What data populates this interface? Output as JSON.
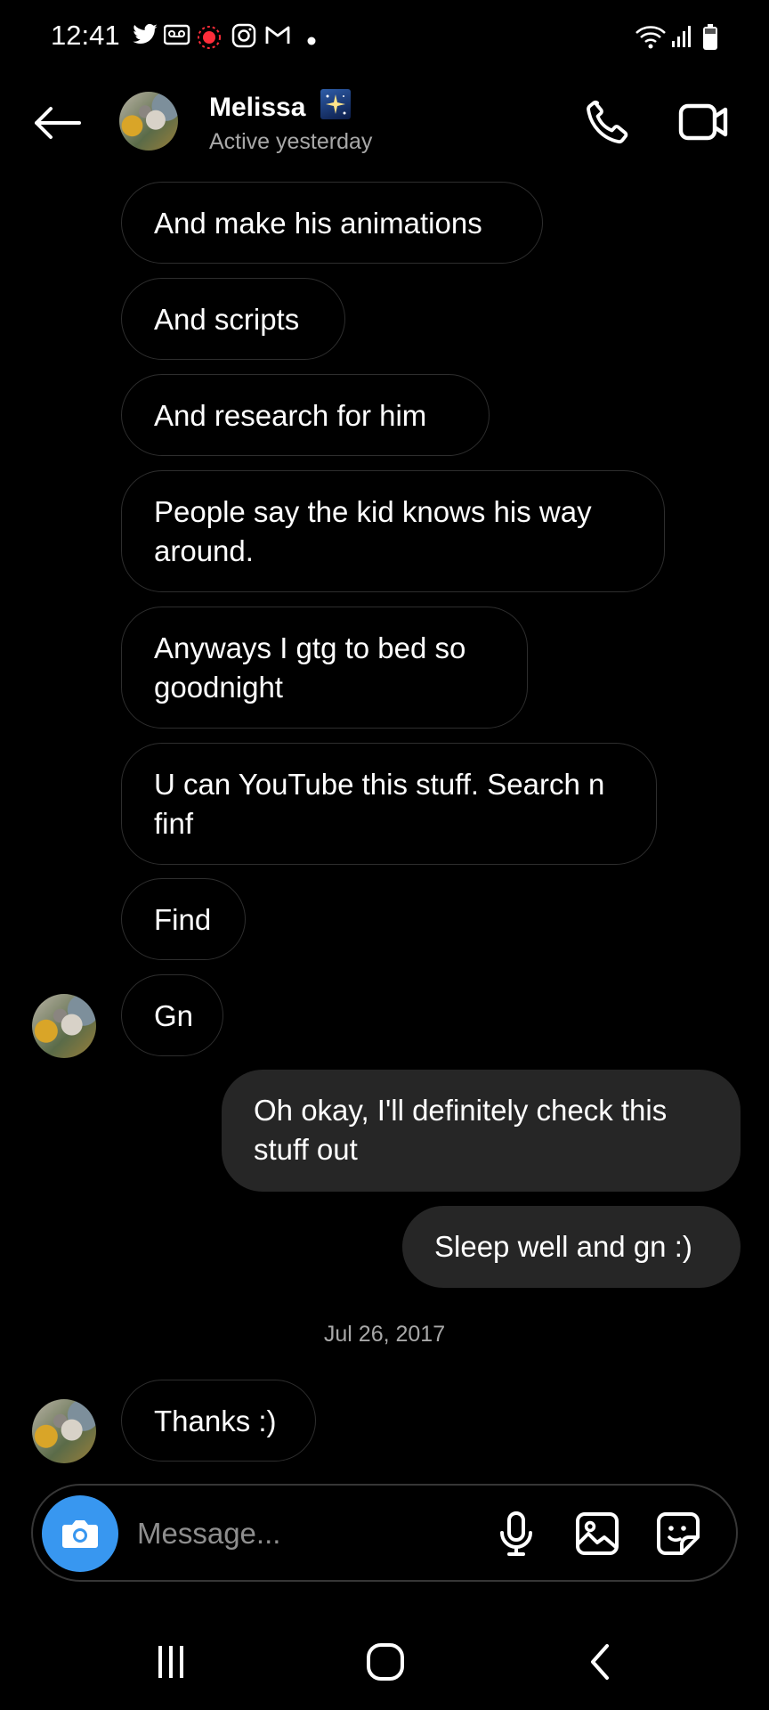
{
  "status_bar": {
    "time": "12:41",
    "icons": [
      "twitter-icon",
      "voicemail-icon",
      "notification-dot-icon",
      "instagram-icon",
      "gmail-icon",
      "dot-icon",
      "wifi-icon",
      "signal-icon",
      "battery-icon"
    ]
  },
  "header": {
    "contact_name": "Melissa",
    "activity_status": "Active yesterday"
  },
  "messages": [
    {
      "from": "them",
      "text": "And make his animations"
    },
    {
      "from": "them",
      "text": "And scripts"
    },
    {
      "from": "them",
      "text": "And research  for him"
    },
    {
      "from": "them",
      "text": "People say the kid knows his way around."
    },
    {
      "from": "them",
      "text": "Anyways I gtg to bed so goodnight"
    },
    {
      "from": "them",
      "text": "U can YouTube this stuff. Search n finf"
    },
    {
      "from": "them",
      "text": "Find"
    },
    {
      "from": "them",
      "text": "Gn"
    },
    {
      "from": "me",
      "text": "Oh okay, I'll definitely check this stuff out"
    },
    {
      "from": "me",
      "text": "Sleep well and gn :)"
    },
    {
      "from": "them",
      "text": "Thanks :)"
    }
  ],
  "date_separator": "Jul 26, 2017",
  "composer": {
    "placeholder": "Message..."
  },
  "colors": {
    "background": "#000000",
    "incoming_border": "#2e2e2e",
    "outgoing_bubble": "#262626",
    "camera_button": "#3897f0",
    "secondary_text": "#a8a8a8"
  }
}
